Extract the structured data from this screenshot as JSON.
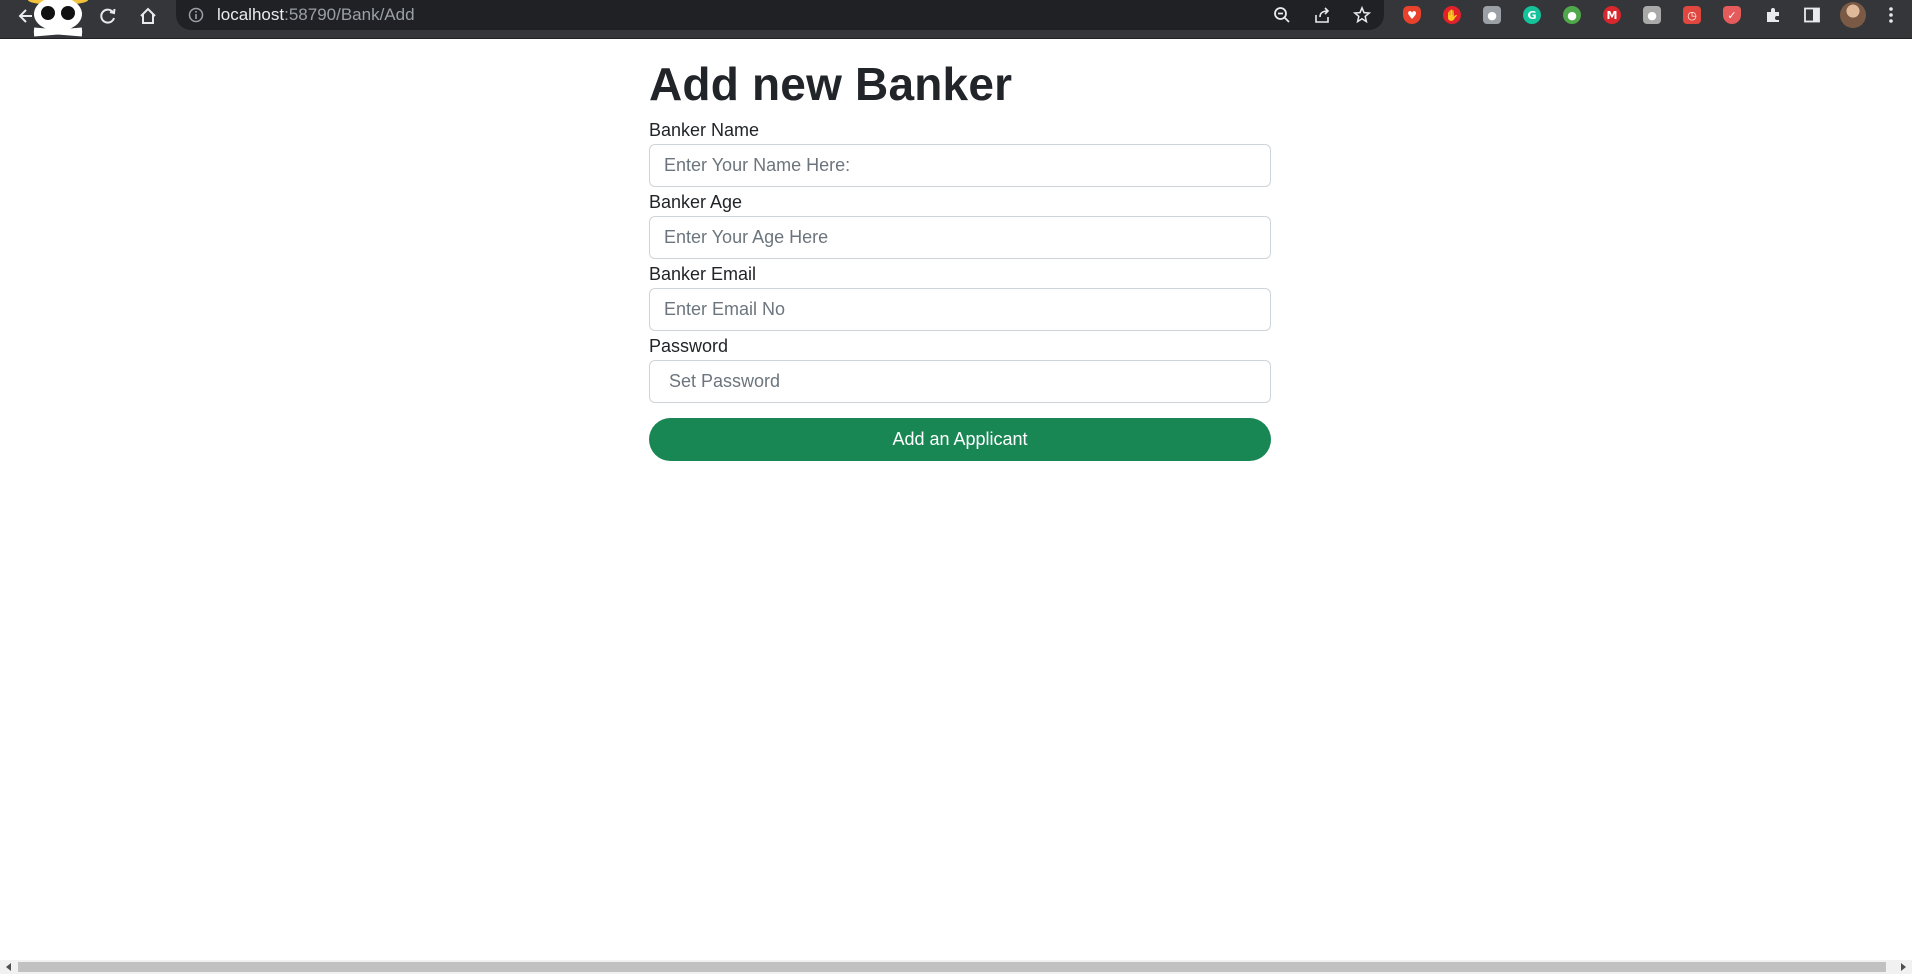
{
  "browser": {
    "url_host": "localhost",
    "url_path": ":58790/Bank/Add",
    "icons": {
      "back": "back-arrow-icon",
      "reload": "reload-icon",
      "home": "home-icon",
      "site_info": "info-icon",
      "zoom": "zoom-out-icon",
      "share": "share-icon",
      "bookmark": "star-icon",
      "extensions": "puzzle-icon",
      "side_panel": "side-panel-icon",
      "menu": "kebab-menu-icon"
    },
    "extensions": [
      {
        "name": "brave-shield-icon",
        "color": "#e8412c"
      },
      {
        "name": "adblock-hand-icon",
        "color": "#e3212b"
      },
      {
        "name": "gray-extension-icon",
        "color": "#9aa0a6"
      },
      {
        "name": "grammarly-icon",
        "color": "#15c39a"
      },
      {
        "name": "globe-extension-icon",
        "color": "#4fa84a"
      },
      {
        "name": "mega-icon",
        "color": "#d9272e"
      },
      {
        "name": "tampermonkey-icon",
        "color": "#a9a9a9"
      },
      {
        "name": "red-timer-icon",
        "color": "#e0473e"
      },
      {
        "name": "shield-extension-icon",
        "color": "#e55b5b"
      }
    ]
  },
  "page": {
    "title": "Add new Banker",
    "fields": [
      {
        "label": "Banker Name",
        "placeholder": "Enter Your Name Here:",
        "value": ""
      },
      {
        "label": "Banker Age",
        "placeholder": "Enter Your Age Here",
        "value": ""
      },
      {
        "label": "Banker Email",
        "placeholder": "Enter Email No",
        "value": ""
      },
      {
        "label": "Password",
        "placeholder": " Set Password",
        "value": ""
      }
    ],
    "submit_label": "Add an Applicant"
  },
  "colors": {
    "toolbar": "#35363a",
    "omnibox": "#202124",
    "submit_button": "#198754",
    "heading_text": "#212529"
  }
}
